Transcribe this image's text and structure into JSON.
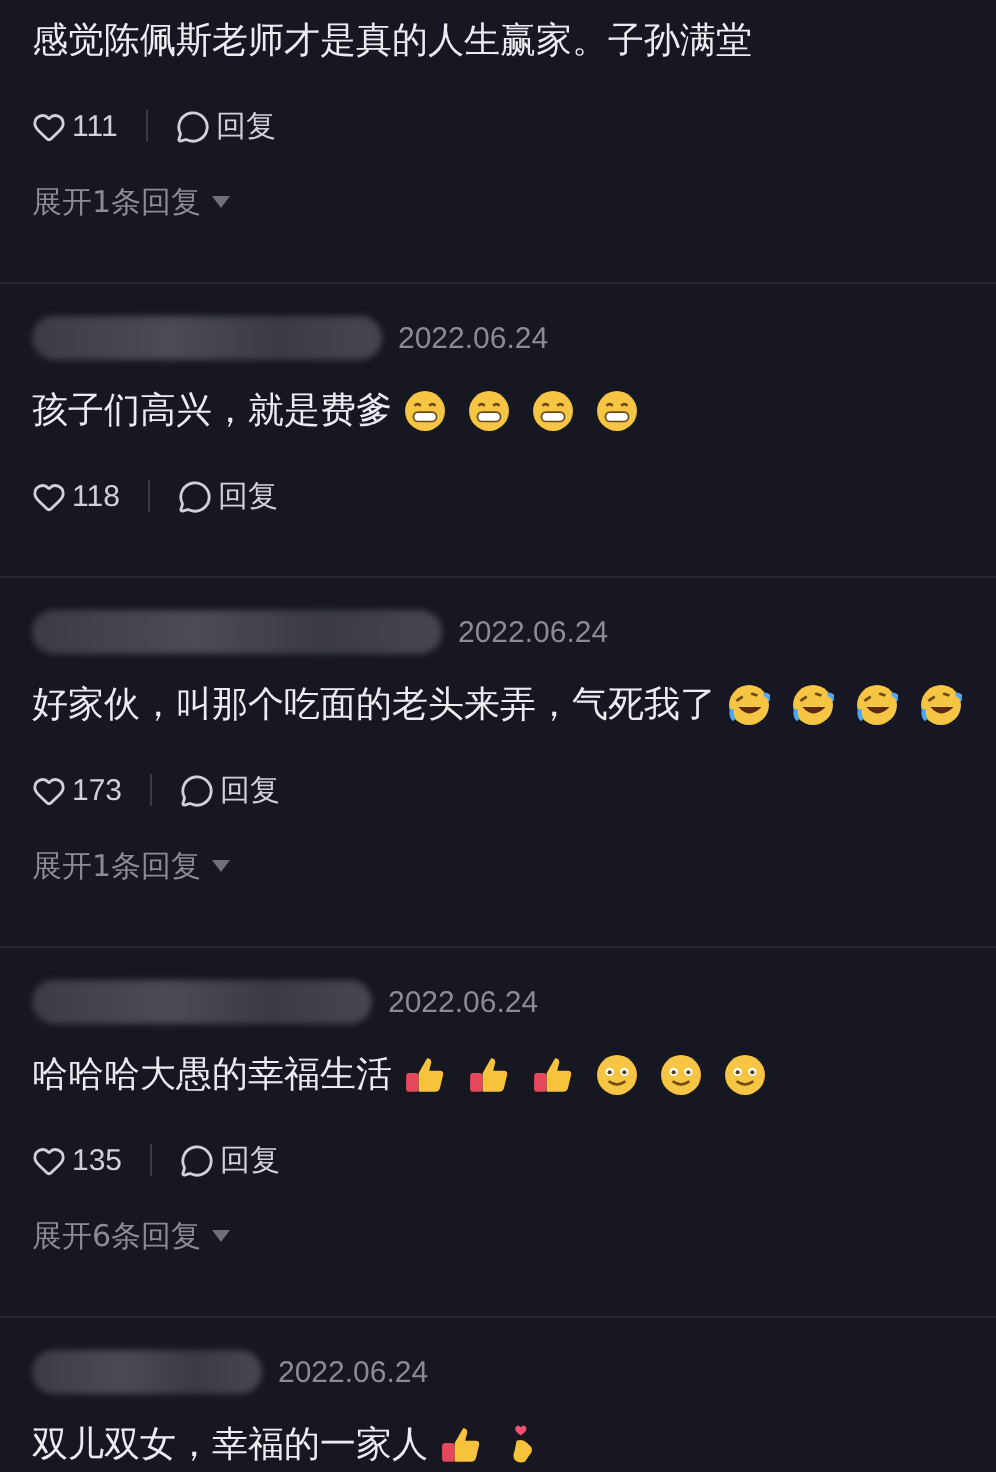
{
  "comments": [
    {
      "text": "感觉陈佩斯老师才是真的人生赢家。子孙满堂",
      "likes": "111",
      "reply_label": "回复",
      "expand": "展开1条回复"
    },
    {
      "date": "2022.06.24",
      "text": "孩子们高兴，就是费爹",
      "emojis": [
        {
          "kind": "grin"
        },
        {
          "kind": "grin"
        },
        {
          "kind": "grin"
        },
        {
          "kind": "grin"
        }
      ],
      "likes": "118",
      "reply_label": "回复"
    },
    {
      "date": "2022.06.24",
      "text": "好家伙，叫那个吃面的老头来弄，气死我了",
      "emojis": [
        {
          "kind": "rofl"
        },
        {
          "kind": "rofl"
        },
        {
          "kind": "rofl"
        },
        {
          "kind": "rofl"
        }
      ],
      "likes": "173",
      "reply_label": "回复",
      "expand": "展开1条回复"
    },
    {
      "date": "2022.06.24",
      "text": "哈哈哈大愚的幸福生活",
      "emojis": [
        {
          "kind": "thumbs"
        },
        {
          "kind": "thumbs"
        },
        {
          "kind": "thumbs"
        },
        {
          "kind": "smile"
        },
        {
          "kind": "smile"
        },
        {
          "kind": "smile"
        }
      ],
      "likes": "135",
      "reply_label": "回复",
      "expand": "展开6条回复"
    },
    {
      "date": "2022.06.24",
      "text": "双儿双女，幸福的一家人",
      "emojis": [
        {
          "kind": "thumbs"
        },
        {
          "kind": "fingerheart"
        }
      ]
    }
  ]
}
